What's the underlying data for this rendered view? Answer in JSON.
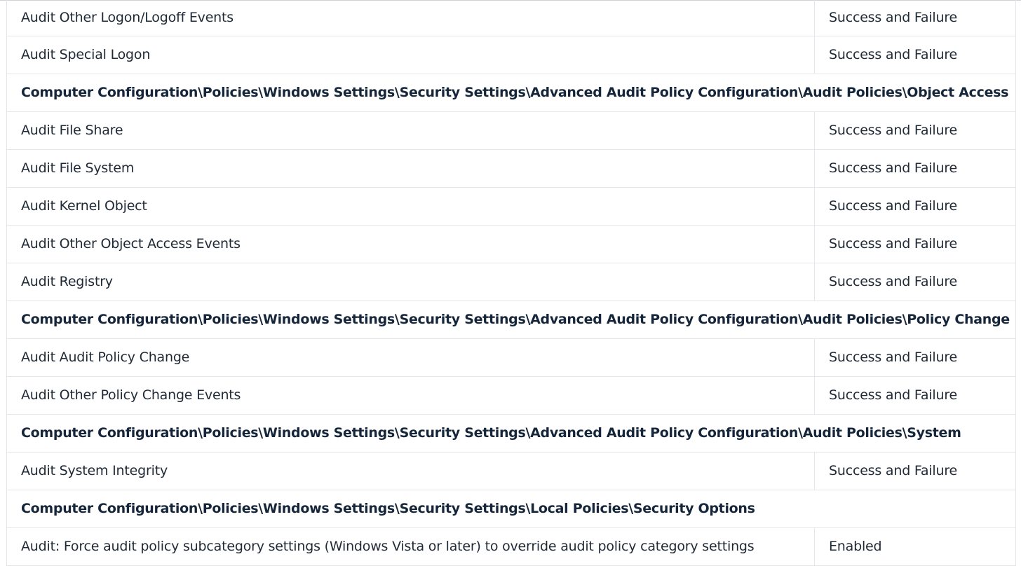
{
  "rows": [
    {
      "type": "setting",
      "name": "Audit Other Logon/Logoff Events",
      "value": "Success and Failure"
    },
    {
      "type": "setting",
      "name": "Audit Special Logon",
      "value": "Success and Failure"
    },
    {
      "type": "section",
      "path": "Computer Configuration\\Policies\\Windows Settings\\Security Settings\\Advanced Audit Policy Configuration\\Audit Policies\\Object Access"
    },
    {
      "type": "setting",
      "name": "Audit File Share",
      "value": "Success and Failure"
    },
    {
      "type": "setting",
      "name": "Audit File System",
      "value": "Success and Failure"
    },
    {
      "type": "setting",
      "name": "Audit Kernel Object",
      "value": "Success and Failure"
    },
    {
      "type": "setting",
      "name": "Audit Other Object Access Events",
      "value": "Success and Failure"
    },
    {
      "type": "setting",
      "name": "Audit Registry",
      "value": "Success and Failure"
    },
    {
      "type": "section",
      "path": "Computer Configuration\\Policies\\Windows Settings\\Security Settings\\Advanced Audit Policy Configuration\\Audit Policies\\Policy Change"
    },
    {
      "type": "setting",
      "name": "Audit Audit Policy Change",
      "value": "Success and Failure"
    },
    {
      "type": "setting",
      "name": "Audit Other Policy Change Events",
      "value": "Success and Failure"
    },
    {
      "type": "section",
      "path": "Computer Configuration\\Policies\\Windows Settings\\Security Settings\\Advanced Audit Policy Configuration\\Audit Policies\\System"
    },
    {
      "type": "setting",
      "name": "Audit System Integrity",
      "value": "Success and Failure"
    },
    {
      "type": "section",
      "path": "Computer Configuration\\Policies\\Windows Settings\\Security Settings\\Local Policies\\Security Options"
    },
    {
      "type": "setting",
      "name": "Audit: Force audit policy subcategory settings (Windows Vista or later) to override audit policy category settings",
      "value": "Enabled"
    }
  ]
}
